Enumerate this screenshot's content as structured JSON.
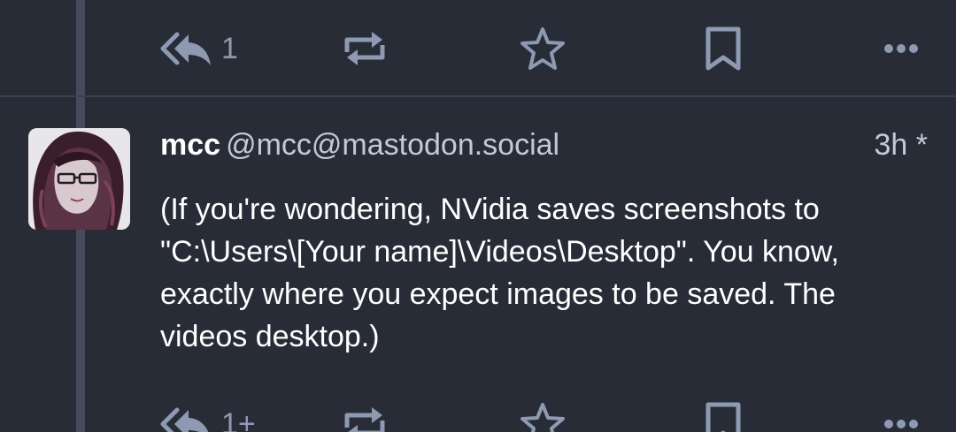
{
  "previous_status": {
    "reply_count": "1",
    "icons": [
      "reply-all-icon",
      "boost-icon",
      "star-icon",
      "bookmark-icon",
      "more-icon"
    ]
  },
  "status": {
    "display_name": "mcc",
    "acct": "@mcc@mastodon.social",
    "timestamp": "3h *",
    "content_lines": [
      "(If you're wondering, NVidia saves screenshots to",
      "\"C:\\Users\\[Your name]\\Videos\\Desktop\". You know,",
      "exactly where you expect images to be saved. The",
      "videos desktop.)"
    ],
    "reply_count": "1+"
  },
  "colors": {
    "background": "#282c37",
    "thread_line": "#444b5d",
    "icon": "#8d9ab2",
    "text": "#ffffff",
    "secondary_text": "#c3c9d6"
  }
}
